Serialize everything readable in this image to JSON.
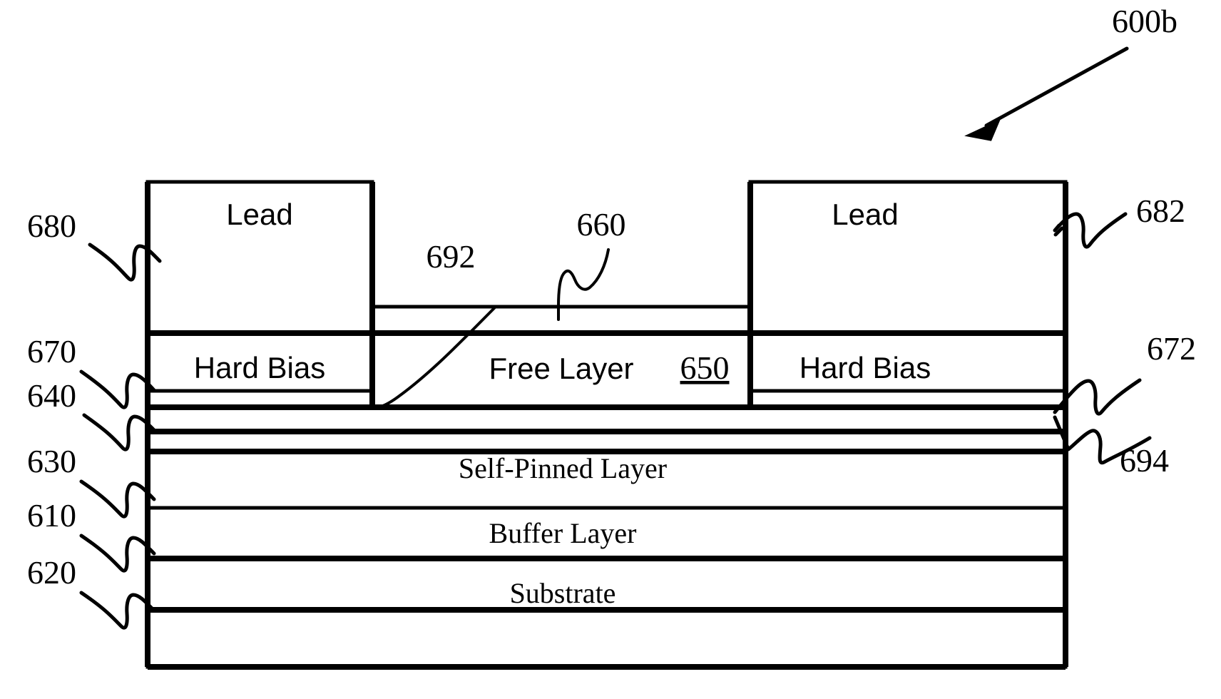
{
  "figure": {
    "title_ref": "600b",
    "background_color": "#ffffff",
    "line_color": "#000000"
  },
  "stack_labels": {
    "lead_left": "Lead",
    "lead_right": "Lead",
    "hard_bias_left": "Hard Bias",
    "hard_bias_right": "Hard Bias",
    "free_layer": "Free Layer",
    "free_layer_ref": "650",
    "self_pinned_layer": "Self-Pinned Layer",
    "buffer_layer": "Buffer Layer",
    "substrate": "Substrate"
  },
  "reference_numerals": {
    "lead_left_ref": "680",
    "lead_right_ref": "682",
    "hard_bias_left_ref": "670",
    "hard_bias_right_ref": "672",
    "seed_left_ref": "640",
    "self_pinned_ref": "630",
    "buffer_ref": "610",
    "substrate_ref": "620",
    "cap_layer_ref": "660",
    "insulator_left_ref": "692",
    "insulator_right_ref": "694"
  }
}
